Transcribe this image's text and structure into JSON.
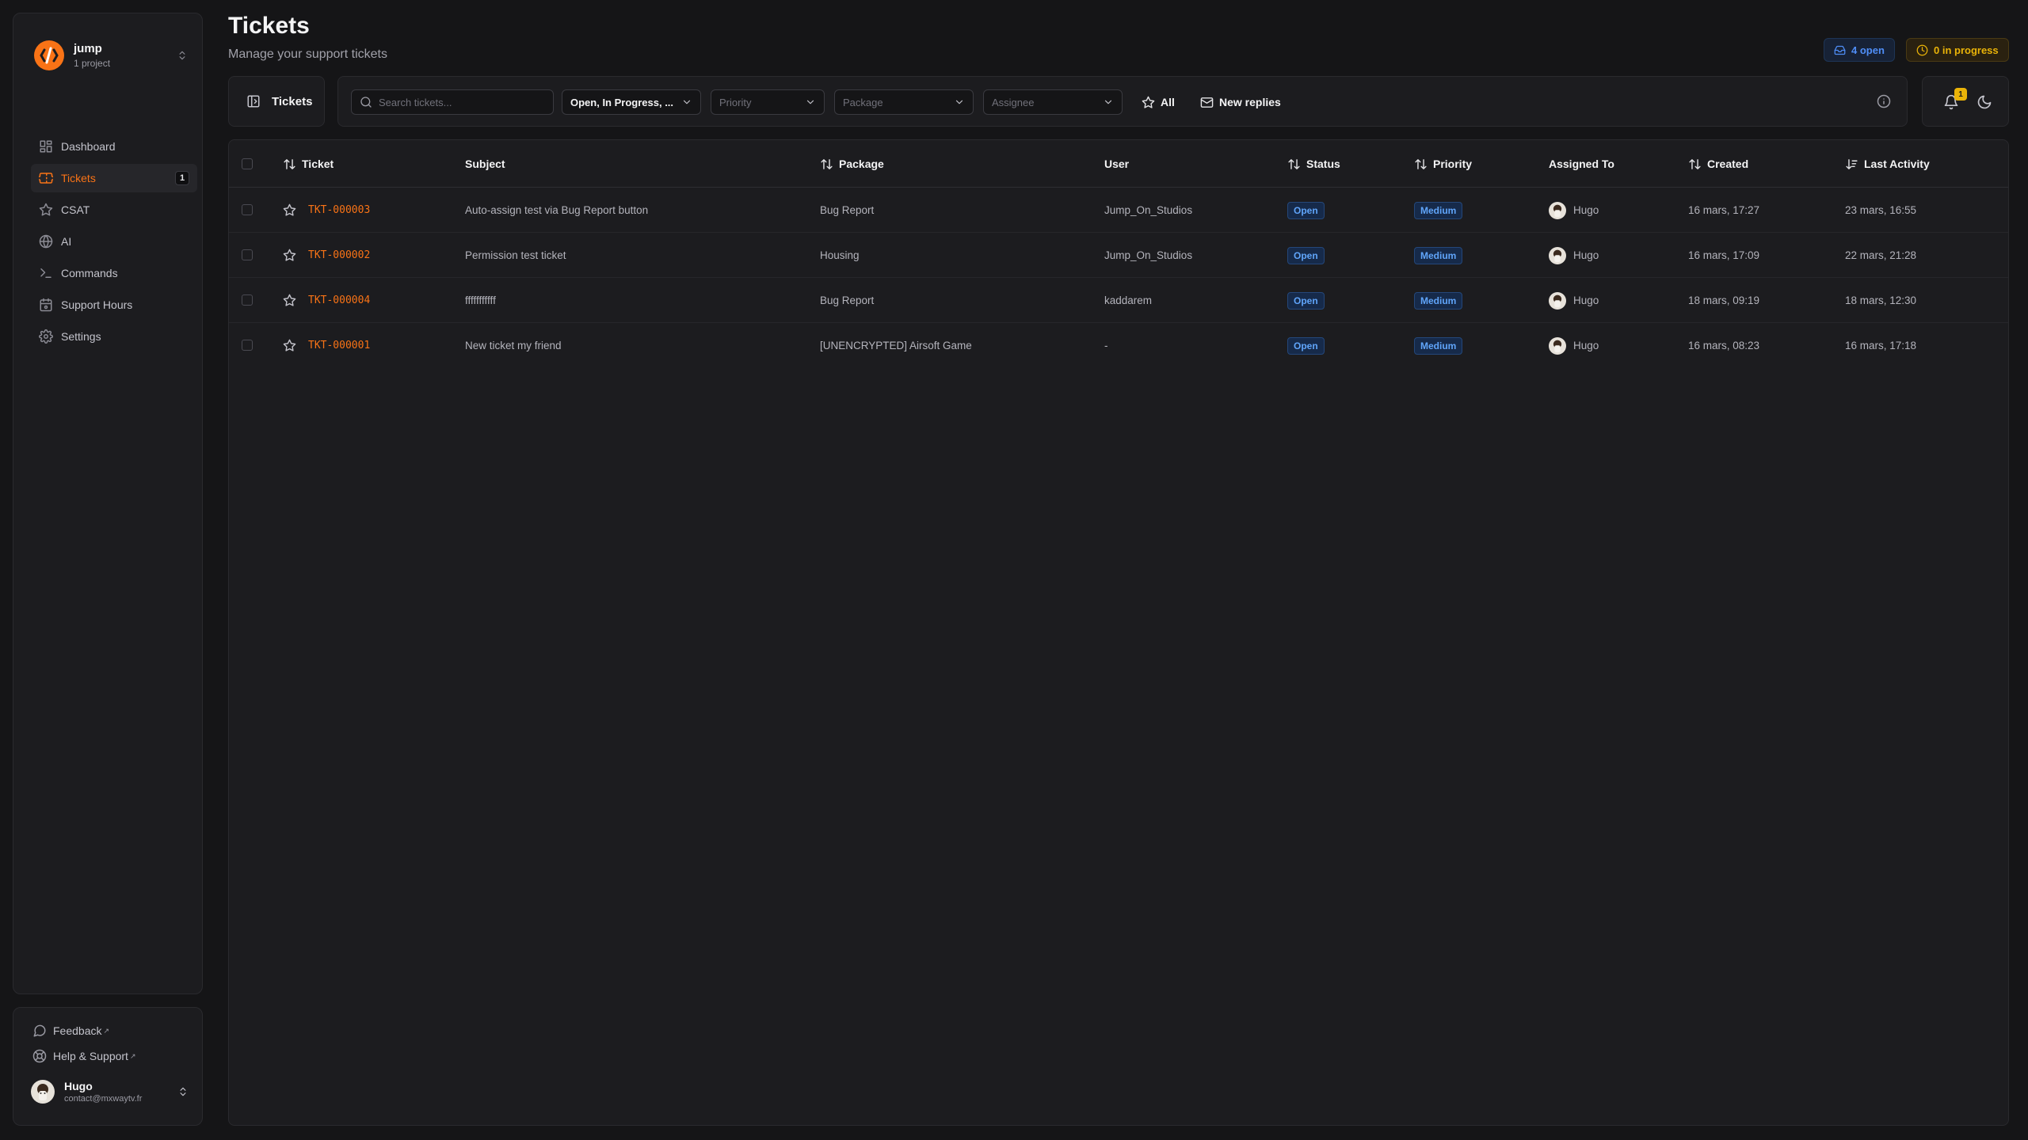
{
  "workspace": {
    "name": "jump",
    "subtitle": "1 project",
    "accent": "#f97316"
  },
  "nav": [
    {
      "label": "Dashboard",
      "icon": "dashboard-icon"
    },
    {
      "label": "Tickets",
      "icon": "ticket-icon",
      "active": true,
      "badge": "1"
    },
    {
      "label": "CSAT",
      "icon": "star-icon"
    },
    {
      "label": "AI",
      "icon": "globe-icon"
    },
    {
      "label": "Commands",
      "icon": "terminal-icon"
    },
    {
      "label": "Support Hours",
      "icon": "calendar-icon"
    },
    {
      "label": "Settings",
      "icon": "gear-icon"
    }
  ],
  "footer": {
    "feedback": "Feedback",
    "help": "Help & Support",
    "ext_mark": "↗",
    "user": {
      "name": "Hugo",
      "email": "contact@mxwaytv.fr"
    }
  },
  "header": {
    "title": "Tickets",
    "subtitle": "Manage your support tickets",
    "open_count": "4 open",
    "in_progress": "0 in progress"
  },
  "toolbar": {
    "view_label": "Tickets",
    "search_placeholder": "Search tickets...",
    "status_value": "Open, In Progress, ...",
    "priority_placeholder": "Priority",
    "package_placeholder": "Package",
    "assignee_placeholder": "Assignee",
    "all_label": "All",
    "new_replies_label": "New replies",
    "notification_count": "1"
  },
  "table": {
    "columns": {
      "ticket": "Ticket",
      "subject": "Subject",
      "package": "Package",
      "user": "User",
      "status": "Status",
      "priority": "Priority",
      "assigned": "Assigned To",
      "created": "Created",
      "last_activity": "Last Activity"
    },
    "rows": [
      {
        "id": "TKT-000003",
        "subject": "Auto-assign test via Bug Report button",
        "package": "Bug Report",
        "user": "Jump_On_Studios",
        "status": "Open",
        "priority": "Medium",
        "assignee": "Hugo",
        "created": "16 mars, 17:27",
        "last_activity": "23 mars, 16:55"
      },
      {
        "id": "TKT-000002",
        "subject": "Permission test ticket",
        "package": "Housing",
        "user": "Jump_On_Studios",
        "status": "Open",
        "priority": "Medium",
        "assignee": "Hugo",
        "created": "16 mars, 17:09",
        "last_activity": "22 mars, 21:28"
      },
      {
        "id": "TKT-000004",
        "subject": "fffffffffff",
        "package": "Bug Report",
        "user": "kaddarem",
        "status": "Open",
        "priority": "Medium",
        "assignee": "Hugo",
        "created": "18 mars, 09:19",
        "last_activity": "18 mars, 12:30"
      },
      {
        "id": "TKT-000001",
        "subject": "New ticket my friend",
        "package": "[UNENCRYPTED] Airsoft Game",
        "user": "-",
        "status": "Open",
        "priority": "Medium",
        "assignee": "Hugo",
        "created": "16 mars, 08:23",
        "last_activity": "16 mars, 17:18"
      }
    ]
  }
}
